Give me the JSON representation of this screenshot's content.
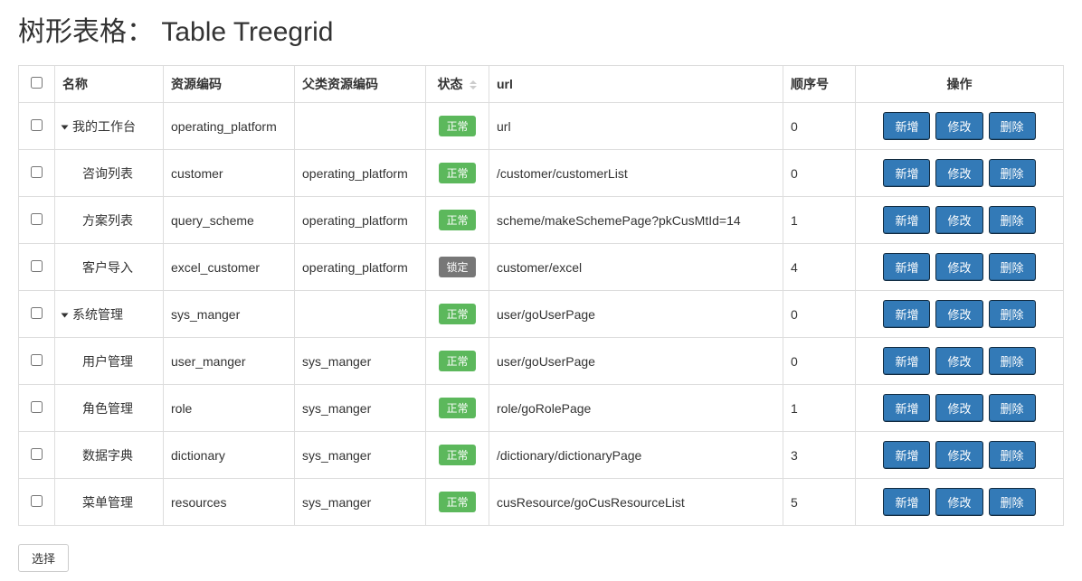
{
  "title": "树形表格： Table Treegrid",
  "headers": {
    "name": "名称",
    "code": "资源编码",
    "parent": "父类资源编码",
    "status": "状态",
    "url": "url",
    "order": "顺序号",
    "actions": "操作"
  },
  "status_labels": {
    "normal": "正常",
    "locked": "锁定"
  },
  "action_labels": {
    "add": "新增",
    "edit": "修改",
    "delete": "删除"
  },
  "select_button": "选择",
  "rows": [
    {
      "name": "我的工作台",
      "code": "operating_platform",
      "parent": "",
      "status": "normal",
      "url": "url",
      "order": "0",
      "level": 0,
      "expanded": true
    },
    {
      "name": "咨询列表",
      "code": "customer",
      "parent": "operating_platform",
      "status": "normal",
      "url": "/customer/customerList",
      "order": "0",
      "level": 1
    },
    {
      "name": "方案列表",
      "code": "query_scheme",
      "parent": "operating_platform",
      "status": "normal",
      "url": "scheme/makeSchemePage?pkCusMtId=14",
      "order": "1",
      "level": 1
    },
    {
      "name": "客户导入",
      "code": "excel_customer",
      "parent": "operating_platform",
      "status": "locked",
      "url": "customer/excel",
      "order": "4",
      "level": 1
    },
    {
      "name": "系统管理",
      "code": "sys_manger",
      "parent": "",
      "status": "normal",
      "url": "user/goUserPage",
      "order": "0",
      "level": 0,
      "expanded": true
    },
    {
      "name": "用户管理",
      "code": "user_manger",
      "parent": "sys_manger",
      "status": "normal",
      "url": "user/goUserPage",
      "order": "0",
      "level": 1
    },
    {
      "name": "角色管理",
      "code": "role",
      "parent": "sys_manger",
      "status": "normal",
      "url": "role/goRolePage",
      "order": "1",
      "level": 1
    },
    {
      "name": "数据字典",
      "code": "dictionary",
      "parent": "sys_manger",
      "status": "normal",
      "url": "/dictionary/dictionaryPage",
      "order": "3",
      "level": 1
    },
    {
      "name": "菜单管理",
      "code": "resources",
      "parent": "sys_manger",
      "status": "normal",
      "url": "cusResource/goCusResourceList",
      "order": "5",
      "level": 1
    }
  ]
}
